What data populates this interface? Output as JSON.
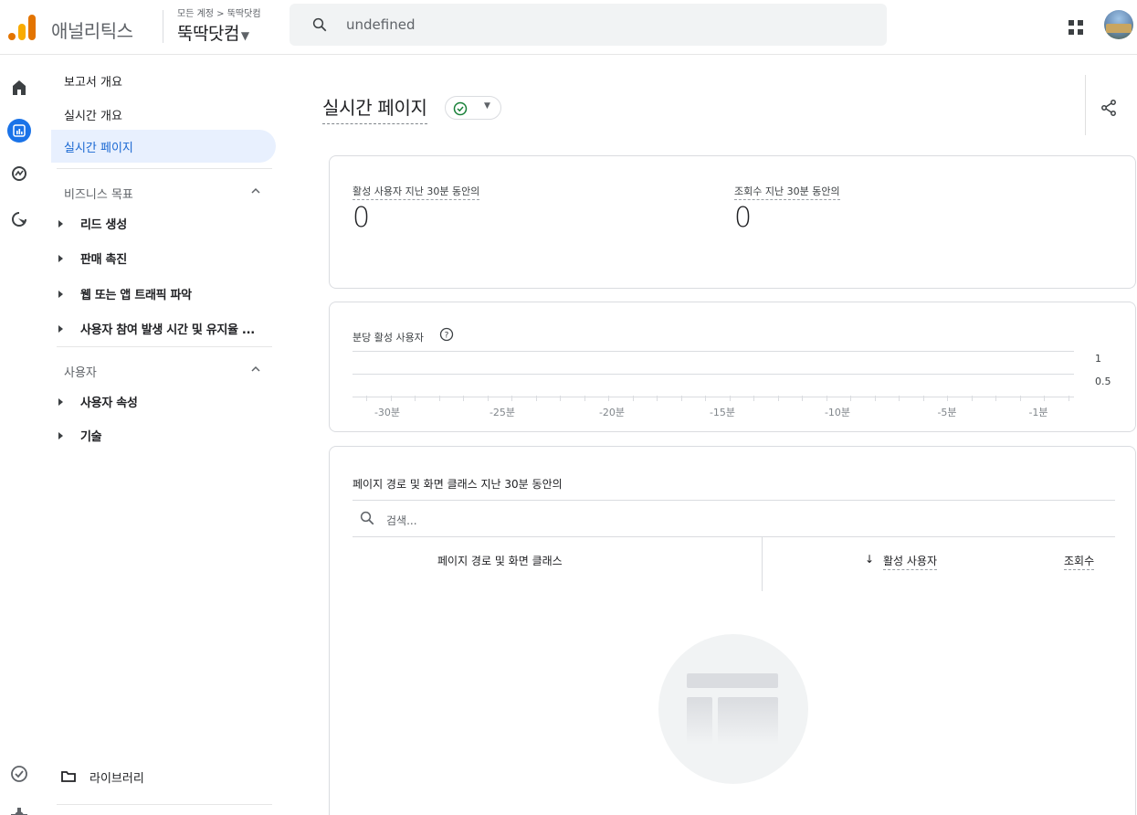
{
  "header": {
    "app_name": "애널리틱스",
    "breadcrumb": "모든 계정 > 뚝딱닷컴",
    "property": "뚝딱닷컴",
    "search_text": "undefined"
  },
  "nav": {
    "top_items": [
      "보고서 개요",
      "실시간 개요",
      "실시간 페이지"
    ],
    "active_index": 2,
    "section_business": "비즈니스 목표",
    "business_items": [
      "리드 생성",
      "판매 촉진",
      "웹 또는 앱 트래픽 파악",
      "사용자 참여 발생 시간 및 유지율 ..."
    ],
    "section_user": "사용자",
    "user_items": [
      "사용자 속성",
      "기술"
    ],
    "library": "라이브러리"
  },
  "page": {
    "title": "실시간 페이지"
  },
  "metrics": [
    {
      "label": "활성 사용자 지난 30분 동안의",
      "value": "0"
    },
    {
      "label": "조회수 지난 30분 동안의",
      "value": "0"
    }
  ],
  "chart_data": {
    "type": "bar",
    "title": "분당 활성 사용자",
    "y_ticks": [
      "1",
      "0.5"
    ],
    "x_ticks": [
      "-30분",
      "-25분",
      "-20분",
      "-15분",
      "-10분",
      "-5분",
      "-1분"
    ],
    "ylim": [
      0,
      1
    ]
  },
  "table": {
    "title": "페이지 경로 및 화면 클래스 지난 30분 동안의",
    "search_placeholder": "검색...",
    "columns": [
      "페이지 경로 및 화면 클래스",
      "활성 사용자",
      "조회수"
    ],
    "sort_arrow": "↓"
  }
}
